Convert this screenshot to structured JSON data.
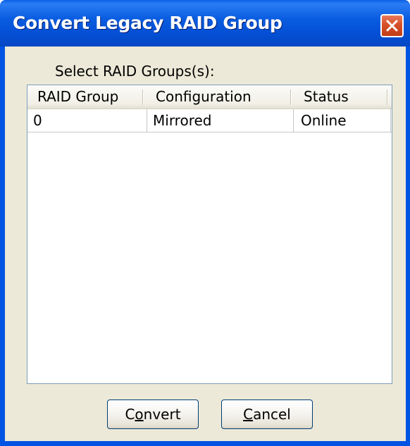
{
  "window": {
    "title": "Convert Legacy RAID Group",
    "close_icon": "close-icon"
  },
  "prompt": {
    "label": "Select RAID Groups(s):"
  },
  "table": {
    "columns": [
      "RAID Group",
      "Configuration",
      "Status"
    ],
    "rows": [
      {
        "raid_group": "0",
        "configuration": "Mirrored",
        "status": "Online"
      }
    ]
  },
  "buttons": {
    "convert": {
      "pre": "C",
      "mnemonic": "o",
      "post": "nvert"
    },
    "cancel": {
      "pre": "",
      "mnemonic": "C",
      "post": "ancel"
    }
  },
  "colors": {
    "titlebar": "#0054e3",
    "dialog_background": "#ece9d8",
    "close_button": "#d6502a",
    "table_border": "#7f9db9"
  }
}
